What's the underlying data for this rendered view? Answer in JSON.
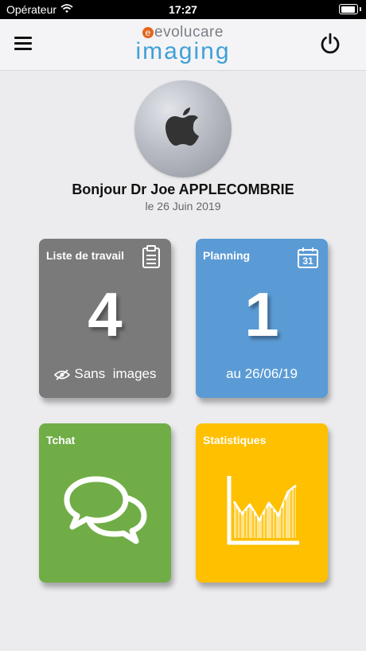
{
  "status_bar": {
    "carrier": "Opérateur",
    "time": "17:27"
  },
  "header": {
    "brand_top": "evolucare",
    "brand_bottom": "imaging",
    "menu_icon": "hamburger-icon",
    "power_icon": "power-icon"
  },
  "profile": {
    "avatar_icon": "apple-logo-icon",
    "greeting": "Bonjour Dr Joe APPLECOMBRIE",
    "date": "le 26 Juin 2019"
  },
  "tiles": {
    "worklist": {
      "title": "Liste de travail",
      "count": "4",
      "footer": "Sans  images",
      "color": "#7a7a7a",
      "icon": "clipboard-icon",
      "footer_icon": "eye-slash-icon"
    },
    "planning": {
      "title": "Planning",
      "count": "1",
      "footer": "au 26/06/19",
      "color": "#5b9bd5",
      "icon": "calendar-icon",
      "calendar_day": "31"
    },
    "chat": {
      "title": "Tchat",
      "color": "#70ad47",
      "icon": "chat-bubbles-icon"
    },
    "stats": {
      "title": "Statistiques",
      "color": "#ffc000",
      "icon": "area-chart-icon"
    }
  }
}
